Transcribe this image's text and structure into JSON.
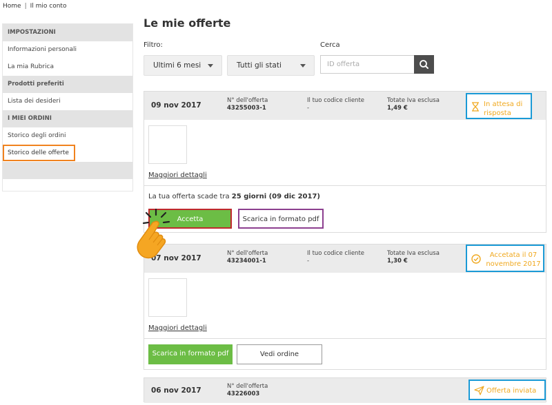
{
  "breadcrumb": {
    "home": "Home",
    "separator": "|",
    "account": "Il mio conto"
  },
  "sidebar": {
    "sections": [
      {
        "heading": "IMPOSTAZIONI",
        "items": [
          "Informazioni personali",
          "La mia Rubrica"
        ]
      },
      {
        "heading": "Prodotti preferiti",
        "items": [
          "Lista dei desideri"
        ]
      },
      {
        "heading": "I MIEI ORDINI",
        "items": [
          "Storico degli ordini",
          "Storico delle offerte"
        ]
      }
    ],
    "active_item": "Storico delle offerte"
  },
  "page": {
    "title": "Le mie offerte"
  },
  "filters": {
    "filter_label": "Filtro:",
    "period_selected": "Ultimi 6 mesi",
    "status_selected": "Tutti gli stati",
    "search_label": "Cerca",
    "search_placeholder": "ID offerta"
  },
  "labels": {
    "offer_number": "N° dell'offerta",
    "client_code": "Il tuo codice cliente",
    "total_excl_vat": "Totate Iva esclusa",
    "more_details": "Maggiori dettagli"
  },
  "offers": [
    {
      "date": "09 nov 2017",
      "number": "43255003-1",
      "client_code": "-",
      "total": "1,49 €",
      "status_line1": "In attesa di",
      "status_line2": "risposta",
      "expiry_prefix": "La tua offerta scade tra ",
      "expiry_bold": "25 giorni (09 dic 2017)",
      "accept_label": "Accetta",
      "pdf_label": "Scarica in formato pdf"
    },
    {
      "date": "07 nov 2017",
      "number": "43234001-1",
      "client_code": "-",
      "total": "1,30 €",
      "status_line1": "Accetata il 07",
      "status_line2": "novembre 2017",
      "pdf_label": "Scarica in formato pdf",
      "view_order_label": "Vedi ordine"
    },
    {
      "date": "06 nov 2017",
      "number": "43226003",
      "status_line1": "Offerta inviata"
    }
  ],
  "colors": {
    "accent_green": "#6cbd45",
    "status_orange": "#f0a81e",
    "status_border_blue": "#1a9ad6",
    "highlight_orange": "#f0821e",
    "highlight_red": "#c0282d",
    "highlight_purple": "#8c3f8f"
  }
}
